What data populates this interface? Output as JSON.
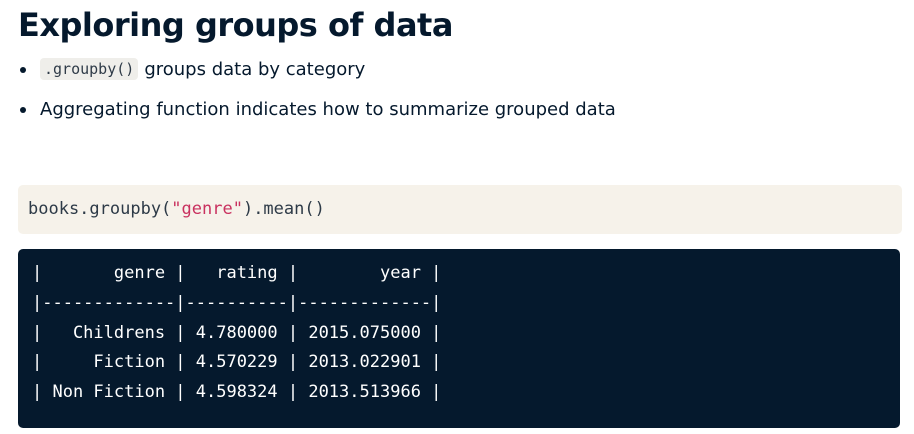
{
  "slide": {
    "title": "Exploring groups of data",
    "bullets": [
      {
        "code": ".groupby()",
        "text": "groups data by category"
      },
      {
        "code": "",
        "text": "Aggregating function indicates how to summarize grouped data"
      }
    ]
  },
  "code_cell": {
    "prefix": "books.groupby(",
    "string": "\"genre\"",
    "suffix": ").mean()"
  },
  "output": {
    "lines": [
      "|       genre |   rating |        year |",
      "|-------------|----------|-------------|",
      "|   Childrens | 4.780000 | 2015.075000 |",
      "|     Fiction | 4.570229 | 2013.022901 |",
      "| Non Fiction | 4.598324 | 2013.513966 |"
    ]
  },
  "colors": {
    "title": "#05192d",
    "code_background": "#f6f2ea",
    "code_string": "#c9315f",
    "output_background": "#05192d",
    "output_text": "#ffffff"
  }
}
